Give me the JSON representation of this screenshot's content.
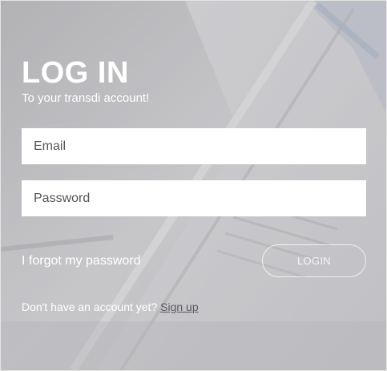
{
  "login": {
    "title": "LOG IN",
    "subtitle": "To your transdi account!",
    "email_placeholder": "Email",
    "password_placeholder": "Password",
    "forgot_password": "I forgot my password",
    "login_button": "LOGIN",
    "signup_prompt": "Don't have an account yet?",
    "signup_link": "Sign up"
  },
  "colors": {
    "overlay": "#96969b",
    "text": "#ffffff",
    "signup_link": "#5a5a5e"
  }
}
